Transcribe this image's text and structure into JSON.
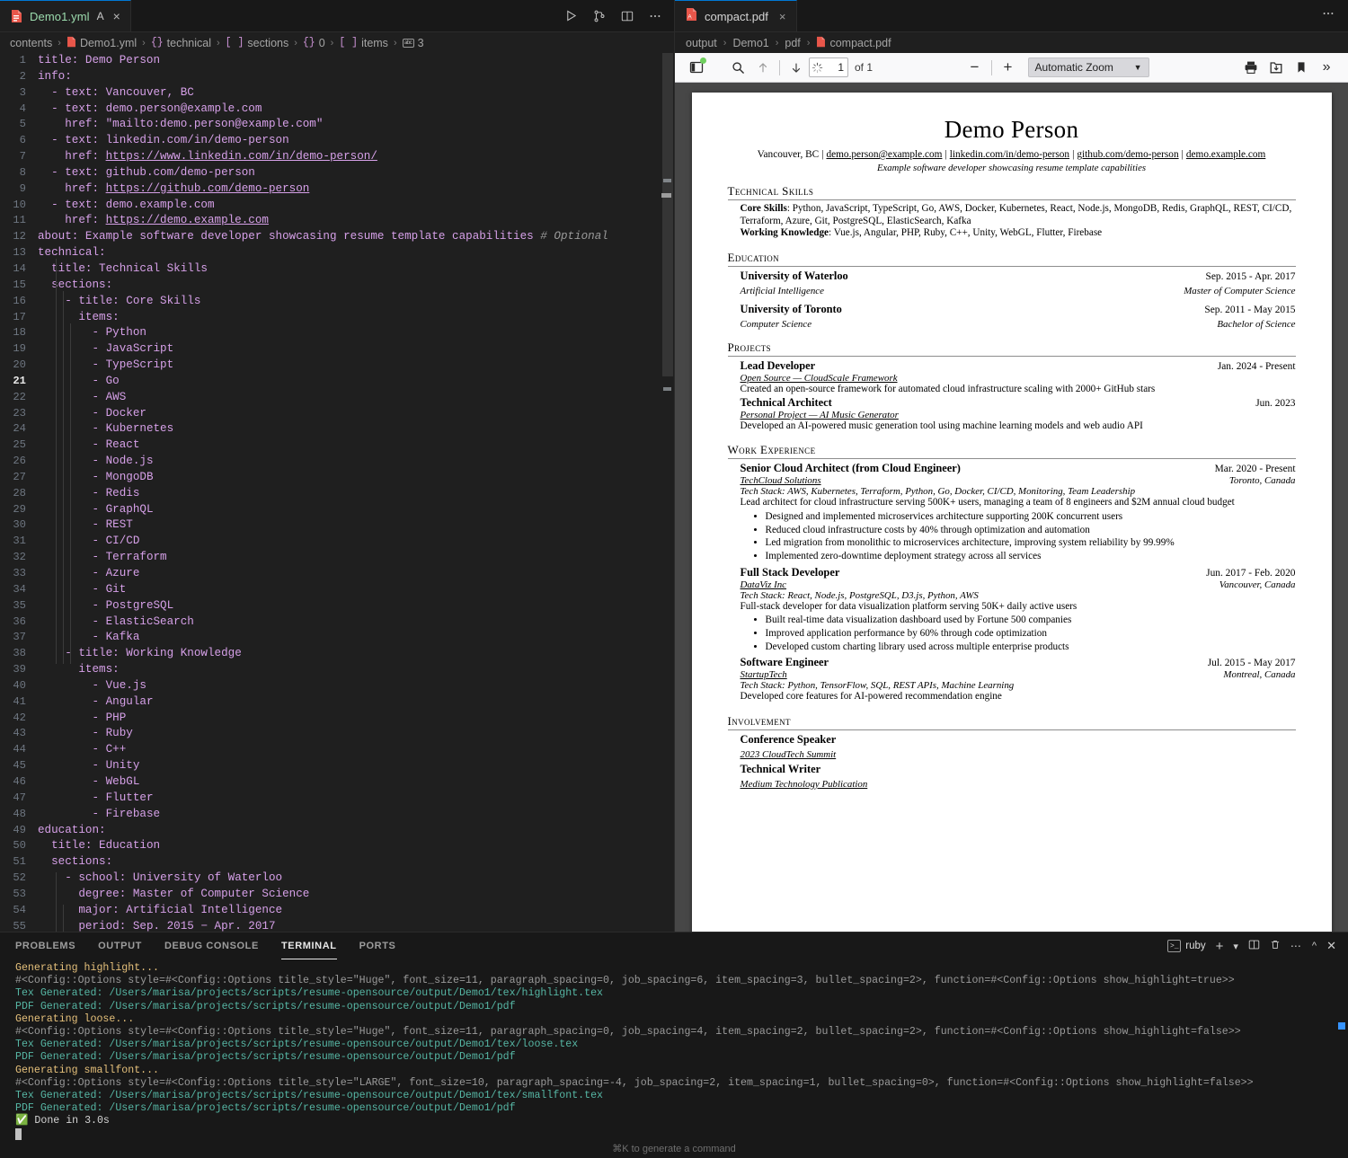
{
  "editor": {
    "tab": {
      "filename": "Demo1.yml",
      "modified_badge": "A",
      "close": "×",
      "file_icon": "yaml-file-icon"
    },
    "actions": [
      {
        "name": "run-button",
        "glyph": "▷"
      },
      {
        "name": "source-control-icon",
        "glyph": "branch"
      },
      {
        "name": "split-editor-icon",
        "glyph": "split"
      },
      {
        "name": "more-actions-icon",
        "glyph": "⋯"
      }
    ],
    "breadcrumb": [
      "contents",
      "Demo1.yml",
      "technical",
      "sections",
      "0",
      "items",
      "3"
    ],
    "lines": [
      {
        "n": 1,
        "html": "<span class='k'>title</span><span class='v'>: Demo Person</span>"
      },
      {
        "n": 2,
        "html": "<span class='k'>info</span><span class='v'>:</span>"
      },
      {
        "n": 3,
        "html": "  <span class='d'>-</span> <span class='k'>text</span><span class='v'>: Vancouver, BC</span>"
      },
      {
        "n": 4,
        "html": "  <span class='d'>-</span> <span class='k'>text</span><span class='v'>: demo.person@example.com</span>"
      },
      {
        "n": 5,
        "html": "    <span class='k'>href</span><span class='v'>: \"mailto:demo.person@example.com\"</span>"
      },
      {
        "n": 6,
        "html": "  <span class='d'>-</span> <span class='k'>text</span><span class='v'>: linkedin.com/in/demo-person</span>"
      },
      {
        "n": 7,
        "html": "    <span class='k'>href</span><span class='v'>: </span><span class='lnk'>https://www.linkedin.com/in/demo-person/</span>"
      },
      {
        "n": 8,
        "html": "  <span class='d'>-</span> <span class='k'>text</span><span class='v'>: github.com/demo-person</span>"
      },
      {
        "n": 9,
        "html": "    <span class='k'>href</span><span class='v'>: </span><span class='lnk'>https://github.com/demo-person</span>"
      },
      {
        "n": 10,
        "html": "  <span class='d'>-</span> <span class='k'>text</span><span class='v'>: demo.example.com</span>"
      },
      {
        "n": 11,
        "html": "    <span class='k'>href</span><span class='v'>: </span><span class='lnk'>https://demo.example.com</span>"
      },
      {
        "n": 12,
        "html": "<span class='k'>about</span><span class='v'>: Example software developer showcasing resume template capabilities</span> <span class='cm'># Optional</span>"
      },
      {
        "n": 13,
        "html": "<span class='k'>technical</span><span class='v'>:</span>"
      },
      {
        "n": 14,
        "html": "  <span class='k'>title</span><span class='v'>: Technical Skills</span>"
      },
      {
        "n": 15,
        "html": "  <span class='k'>sections</span><span class='v'>:</span>"
      },
      {
        "n": 16,
        "html": "    <span class='d'>-</span> <span class='k'>title</span><span class='v'>: Core Skills</span>"
      },
      {
        "n": 17,
        "html": "      <span class='k'>items</span><span class='v'>:</span>"
      },
      {
        "n": 18,
        "html": "        <span class='d'>-</span> <span class='v'>Python</span>"
      },
      {
        "n": 19,
        "html": "        <span class='d'>-</span> <span class='v'>JavaScript</span>"
      },
      {
        "n": 20,
        "html": "        <span class='d'>-</span> <span class='v'>TypeScript</span>"
      },
      {
        "n": 21,
        "html": "        <span class='d'>-</span> <span class='v'>Go</span>",
        "active": true
      },
      {
        "n": 22,
        "html": "        <span class='d'>-</span> <span class='v'>AWS</span>"
      },
      {
        "n": 23,
        "html": "        <span class='d'>-</span> <span class='v'>Docker</span>"
      },
      {
        "n": 24,
        "html": "        <span class='d'>-</span> <span class='v'>Kubernetes</span>"
      },
      {
        "n": 25,
        "html": "        <span class='d'>-</span> <span class='v'>React</span>"
      },
      {
        "n": 26,
        "html": "        <span class='d'>-</span> <span class='v'>Node.js</span>"
      },
      {
        "n": 27,
        "html": "        <span class='d'>-</span> <span class='v'>MongoDB</span>"
      },
      {
        "n": 28,
        "html": "        <span class='d'>-</span> <span class='v'>Redis</span>"
      },
      {
        "n": 29,
        "html": "        <span class='d'>-</span> <span class='v'>GraphQL</span>"
      },
      {
        "n": 30,
        "html": "        <span class='d'>-</span> <span class='v'>REST</span>"
      },
      {
        "n": 31,
        "html": "        <span class='d'>-</span> <span class='v'>CI/CD</span>"
      },
      {
        "n": 32,
        "html": "        <span class='d'>-</span> <span class='v'>Terraform</span>"
      },
      {
        "n": 33,
        "html": "        <span class='d'>-</span> <span class='v'>Azure</span>"
      },
      {
        "n": 34,
        "html": "        <span class='d'>-</span> <span class='v'>Git</span>"
      },
      {
        "n": 35,
        "html": "        <span class='d'>-</span> <span class='v'>PostgreSQL</span>"
      },
      {
        "n": 36,
        "html": "        <span class='d'>-</span> <span class='v'>ElasticSearch</span>"
      },
      {
        "n": 37,
        "html": "        <span class='d'>-</span> <span class='v'>Kafka</span>"
      },
      {
        "n": 38,
        "html": "    <span class='d'>-</span> <span class='k'>title</span><span class='v'>: Working Knowledge</span>"
      },
      {
        "n": 39,
        "html": "      <span class='k'>items</span><span class='v'>:</span>"
      },
      {
        "n": 40,
        "html": "        <span class='d'>-</span> <span class='v'>Vue.js</span>"
      },
      {
        "n": 41,
        "html": "        <span class='d'>-</span> <span class='v'>Angular</span>"
      },
      {
        "n": 42,
        "html": "        <span class='d'>-</span> <span class='v'>PHP</span>"
      },
      {
        "n": 43,
        "html": "        <span class='d'>-</span> <span class='v'>Ruby</span>"
      },
      {
        "n": 44,
        "html": "        <span class='d'>-</span> <span class='v'>C++</span>"
      },
      {
        "n": 45,
        "html": "        <span class='d'>-</span> <span class='v'>Unity</span>"
      },
      {
        "n": 46,
        "html": "        <span class='d'>-</span> <span class='v'>WebGL</span>"
      },
      {
        "n": 47,
        "html": "        <span class='d'>-</span> <span class='v'>Flutter</span>"
      },
      {
        "n": 48,
        "html": "        <span class='d'>-</span> <span class='v'>Firebase</span>"
      },
      {
        "n": 49,
        "html": "<span class='k'>education</span><span class='v'>:</span>"
      },
      {
        "n": 50,
        "html": "  <span class='k'>title</span><span class='v'>: Education</span>"
      },
      {
        "n": 51,
        "html": "  <span class='k'>sections</span><span class='v'>:</span>"
      },
      {
        "n": 52,
        "html": "    <span class='d'>-</span> <span class='k'>school</span><span class='v'>: University of Waterloo</span>"
      },
      {
        "n": 53,
        "html": "      <span class='k'>degree</span><span class='v'>: Master of Computer Science</span>"
      },
      {
        "n": 54,
        "html": "      <span class='k'>major</span><span class='v'>: Artificial Intelligence</span>"
      },
      {
        "n": 55,
        "html": "      <span class='k'>period</span><span class='v'>: Sep. 2015 &minus; Apr. 2017</span>"
      }
    ]
  },
  "pdf": {
    "tab": {
      "filename": "compact.pdf",
      "close": "×"
    },
    "more_actions": "⋯",
    "breadcrumb": [
      "output",
      "Demo1",
      "pdf",
      "compact.pdf"
    ],
    "toolbar": {
      "sidebar_toggle": "sidebar-toggle-icon",
      "find": "search-icon",
      "prev_page": "arrow-up-icon",
      "next_page": "arrow-down-icon",
      "page_number": "1",
      "page_total": "of 1",
      "zoom_out": "−",
      "zoom_in": "+",
      "zoom_value": "Automatic Zoom",
      "print": "print-icon",
      "save": "save-icon",
      "bookmark": "bookmark-icon",
      "more_tools": "»"
    }
  },
  "resume": {
    "name": "Demo Person",
    "contact": [
      {
        "text": "Vancouver, BC",
        "link": false
      },
      {
        "text": "demo.person@example.com",
        "link": true
      },
      {
        "text": "linkedin.com/in/demo-person",
        "link": true
      },
      {
        "text": "github.com/demo-person",
        "link": true
      },
      {
        "text": "demo.example.com",
        "link": true
      }
    ],
    "about": "Example software developer showcasing resume template capabilities",
    "sections": {
      "technical": {
        "heading": "Technical Skills",
        "core_label": "Core Skills",
        "core_value": ": Python, JavaScript, TypeScript, Go, AWS, Docker, Kubernetes, React, Node.js, MongoDB, Redis, GraphQL, REST, CI/CD, Terraform, Azure, Git, PostgreSQL, ElasticSearch, Kafka",
        "working_label": "Working Knowledge",
        "working_value": ": Vue.js, Angular, PHP, Ruby, C++, Unity, WebGL, Flutter, Firebase"
      },
      "education": {
        "heading": "Education",
        "entries": [
          {
            "school": "University of Waterloo",
            "date": "Sep. 2015 - Apr. 2017",
            "major": "Artificial Intelligence",
            "degree": "Master of Computer Science"
          },
          {
            "school": "University of Toronto",
            "date": "Sep. 2011 - May 2015",
            "major": "Computer Science",
            "degree": "Bachelor of Science"
          }
        ]
      },
      "projects": {
        "heading": "Projects",
        "entries": [
          {
            "title": "Lead Developer",
            "date": "Jan. 2024 - Present",
            "sub": "Open Source — CloudScale Framework",
            "desc": "Created an open-source framework for automated cloud infrastructure scaling with 2000+ GitHub stars"
          },
          {
            "title": "Technical Architect",
            "date": "Jun. 2023",
            "sub": "Personal Project — AI Music Generator",
            "desc": "Developed an AI-powered music generation tool using machine learning models and web audio API"
          }
        ]
      },
      "work": {
        "heading": "Work Experience",
        "entries": [
          {
            "title": "Senior Cloud Architect (from Cloud Engineer)",
            "date": "Mar. 2020 - Present",
            "company": "TechCloud Solutions",
            "location": "Toronto, Canada",
            "stack": "Tech Stack: AWS, Kubernetes, Terraform, Python, Go, Docker, CI/CD, Monitoring, Team Leadership",
            "desc": "Lead architect for cloud infrastructure serving 500K+ users, managing a team of 8 engineers and $2M annual cloud budget",
            "bullets": [
              "Designed and implemented microservices architecture supporting 200K concurrent users",
              "Reduced cloud infrastructure costs by 40% through optimization and automation",
              "Led migration from monolithic to microservices architecture, improving system reliability by 99.99%",
              "Implemented zero-downtime deployment strategy across all services"
            ]
          },
          {
            "title": "Full Stack Developer",
            "date": "Jun. 2017 - Feb. 2020",
            "company": "DataViz Inc",
            "location": "Vancouver, Canada",
            "stack": "Tech Stack: React, Node.js, PostgreSQL, D3.js, Python, AWS",
            "desc": "Full-stack developer for data visualization platform serving 50K+ daily active users",
            "bullets": [
              "Built real-time data visualization dashboard used by Fortune 500 companies",
              "Improved application performance by 60% through code optimization",
              "Developed custom charting library used across multiple enterprise products"
            ]
          },
          {
            "title": "Software Engineer",
            "date": "Jul. 2015 - May 2017",
            "company": "StartupTech",
            "location": "Montreal, Canada",
            "stack": "Tech Stack: Python, TensorFlow, SQL, REST APIs, Machine Learning",
            "desc": "Developed core features for AI-powered recommendation engine",
            "bullets": []
          }
        ]
      },
      "involvement": {
        "heading": "Involvement",
        "entries": [
          {
            "title": "Conference Speaker",
            "sub": "2023 CloudTech Summit"
          },
          {
            "title": "Technical Writer",
            "sub": "Medium Technology Publication"
          }
        ]
      }
    }
  },
  "panel": {
    "tabs": [
      {
        "label": "PROBLEMS",
        "active": false
      },
      {
        "label": "OUTPUT",
        "active": false
      },
      {
        "label": "DEBUG CONSOLE",
        "active": false
      },
      {
        "label": "TERMINAL",
        "active": true
      },
      {
        "label": "PORTS",
        "active": false
      }
    ],
    "terminal_name": "ruby",
    "actions": [
      {
        "name": "new-terminal-button",
        "glyph": "+"
      },
      {
        "name": "terminal-profile-chevron-icon",
        "glyph": "⌄"
      },
      {
        "name": "split-terminal-icon",
        "glyph": "split"
      },
      {
        "name": "kill-terminal-icon",
        "glyph": "trash"
      },
      {
        "name": "panel-more-actions-icon",
        "glyph": "⋯"
      },
      {
        "name": "maximize-panel-icon",
        "glyph": "⌃"
      },
      {
        "name": "close-panel-icon",
        "glyph": "✕"
      }
    ],
    "lines": [
      {
        "c": "t-yellow",
        "text": "Generating highlight..."
      },
      {
        "c": "t-gray",
        "text": "#<Config::Options style=#<Config::Options title_style=\"Huge\", font_size=11, paragraph_spacing=0, job_spacing=6, item_spacing=3, bullet_spacing=2>, function=#<Config::Options show_highlight=true>>"
      },
      {
        "c": "t-green",
        "text": "Tex Generated: /Users/marisa/projects/scripts/resume-opensource/output/Demo1/tex/highlight.tex"
      },
      {
        "c": "t-green",
        "text": "PDF Generated: /Users/marisa/projects/scripts/resume-opensource/output/Demo1/pdf"
      },
      {
        "c": "t-yellow",
        "text": "Generating loose..."
      },
      {
        "c": "t-gray",
        "text": "#<Config::Options style=#<Config::Options title_style=\"Huge\", font_size=11, paragraph_spacing=0, job_spacing=4, item_spacing=2, bullet_spacing=2>, function=#<Config::Options show_highlight=false>>"
      },
      {
        "c": "t-green",
        "text": "Tex Generated: /Users/marisa/projects/scripts/resume-opensource/output/Demo1/tex/loose.tex"
      },
      {
        "c": "t-green",
        "text": "PDF Generated: /Users/marisa/projects/scripts/resume-opensource/output/Demo1/pdf"
      },
      {
        "c": "t-yellow",
        "text": "Generating smallfont..."
      },
      {
        "c": "t-gray",
        "text": "#<Config::Options style=#<Config::Options title_style=\"LARGE\", font_size=10, paragraph_spacing=-4, job_spacing=2, item_spacing=1, bullet_spacing=0>, function=#<Config::Options show_highlight=false>>"
      },
      {
        "c": "t-green",
        "text": "Tex Generated: /Users/marisa/projects/scripts/resume-opensource/output/Demo1/tex/smallfont.tex"
      },
      {
        "c": "t-green",
        "text": "PDF Generated: /Users/marisa/projects/scripts/resume-opensource/output/Demo1/pdf"
      },
      {
        "c": "t-white",
        "text": "Done in 3.0s",
        "check": true
      }
    ],
    "hint": "⌘K to generate a command"
  },
  "colors": {
    "accent": "#0078d4",
    "yaml_value": "#d6a0e8",
    "terminal_green": "#56b6a4",
    "terminal_yellow": "#e5c07b",
    "success": "#2ea043"
  }
}
